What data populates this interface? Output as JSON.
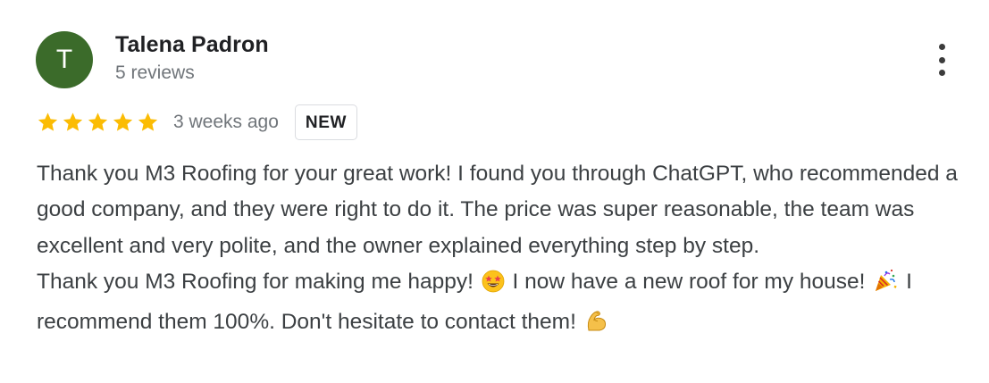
{
  "review": {
    "avatar_initial": "T",
    "avatar_color": "#3b6b2a",
    "author_name": "Talena Padron",
    "author_reviews": "5 reviews",
    "rating": 5,
    "rating_max": 5,
    "star_color": "#fbbc04",
    "time_ago": "3 weeks ago",
    "badge": "NEW",
    "menu_icon": "more-vert-icon",
    "paragraph1": "Thank you M3 Roofing for your great work! I found you through ChatGPT, who recommended a good company, and they were right to do it. The price was super reasonable, the team was excellent and very polite, and the owner explained everything step by step.",
    "paragraph2_part1": "Thank you M3 Roofing for making me happy!",
    "paragraph2_part2": "I now have a new roof for my house!",
    "paragraph2_part3": "I recommend them 100%. Don't hesitate to contact them!",
    "emoji_1": "star-struck-emoji",
    "emoji_2": "party-popper-emoji",
    "emoji_3": "flexed-biceps-emoji"
  }
}
